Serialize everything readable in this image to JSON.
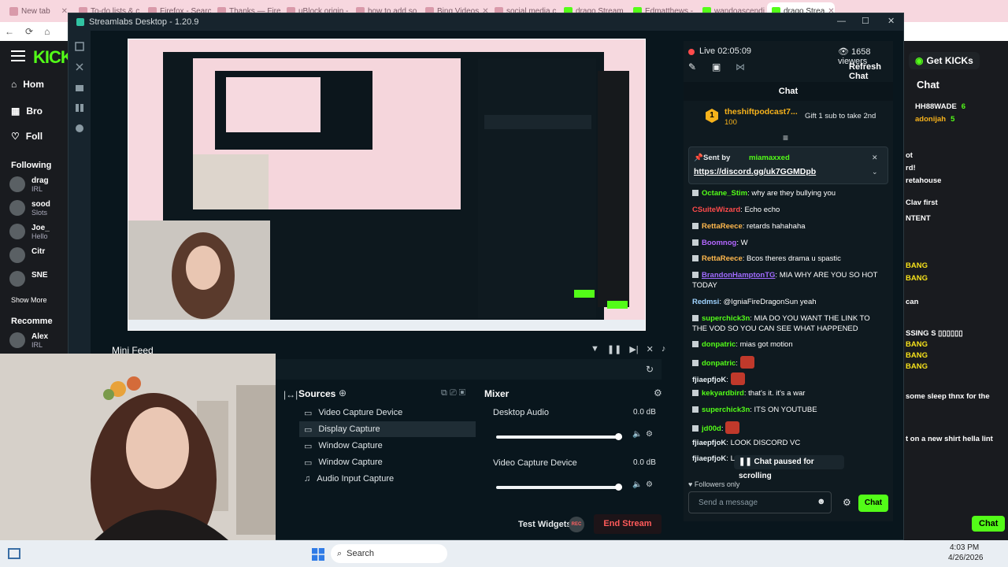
{
  "browser": {
    "tabs": [
      {
        "label": "New tab",
        "active": false,
        "kick": false
      },
      {
        "label": "To-do lists & c",
        "active": false,
        "kick": false
      },
      {
        "label": "Firefox - Search",
        "active": false,
        "kick": false
      },
      {
        "label": "Thanks — Firef",
        "active": false,
        "kick": false
      },
      {
        "label": "uBlock origin -",
        "active": false,
        "kick": false
      },
      {
        "label": "how to add so",
        "active": false,
        "kick": false
      },
      {
        "label": "Bing Videos",
        "active": false,
        "kick": false
      },
      {
        "label": "social media c",
        "active": false,
        "kick": false
      },
      {
        "label": "drago Stream",
        "active": false,
        "kick": true
      },
      {
        "label": "Edmatthews -",
        "active": false,
        "kick": true
      },
      {
        "label": "wandoascendi",
        "active": false,
        "kick": true
      },
      {
        "label": "drago Strea",
        "active": true,
        "kick": true
      }
    ]
  },
  "kick": {
    "logo": "KICK",
    "nav": [
      {
        "icon": "home-icon",
        "label": "Hom"
      },
      {
        "icon": "browse-icon",
        "label": "Bro"
      },
      {
        "icon": "heart-icon",
        "label": "Foll"
      }
    ],
    "following_label": "Following",
    "following": [
      {
        "name": "drag",
        "sub": "IRL"
      },
      {
        "name": "sood",
        "sub": "Slots"
      },
      {
        "name": "Joe_",
        "sub": "Hello"
      },
      {
        "name": "Citr",
        "sub": ""
      },
      {
        "name": "SNE",
        "sub": ""
      }
    ],
    "show_more": "Show More",
    "recommended_label": "Recomme",
    "recommended": [
      {
        "name": "Alex",
        "sub": "IRL"
      }
    ],
    "get_kicks": "Get KICKs",
    "right_chat_label": "Chat",
    "right_chat_lines": [
      {
        "user": "HH88WADE",
        "val": "6"
      },
      {
        "user": "adonijah",
        "val": "5"
      },
      {
        "text": "ot"
      },
      {
        "text": "rd!"
      },
      {
        "text": "retahouse"
      },
      {
        "text": "Clav first"
      },
      {
        "text": "NTENT"
      },
      {
        "text": "BANG"
      },
      {
        "text": "BANG"
      },
      {
        "text": "can"
      },
      {
        "text": "SSING S ▯▯▯▯▯▯"
      },
      {
        "text": "BANG"
      },
      {
        "text": "BANG"
      },
      {
        "text": "BANG"
      },
      {
        "text": "some sleep thnx for the"
      },
      {
        "text": "t on a new shirt hella lint"
      }
    ],
    "right_chat_button": "Chat"
  },
  "streamlabs": {
    "title": "Streamlabs Desktop - 1.20.9",
    "live_label": "Live 02:05:09",
    "viewers": "1658 viewers",
    "refresh_chat": "Refresh Chat",
    "chat_header": "Chat",
    "gift": {
      "user": "theshiftpodcast7...",
      "amount": "100",
      "text": "Gift 1 sub to take 2nd",
      "badge": "1"
    },
    "pinned": {
      "sent_by": "Sent by",
      "user": "miamaxxed",
      "link": "https://discord.gg/uk7GGMDpb"
    },
    "messages": [
      {
        "user": "Octane_Stim",
        "color": "#53fc18",
        "badge": true,
        "text": "why are they bullying you"
      },
      {
        "user": "CSuiteWizard",
        "color": "#ff4b4b",
        "badge": false,
        "text": "Echo echo"
      },
      {
        "user": "RettaReece",
        "color": "#ffb84d",
        "badge": true,
        "text": "retards hahahaha"
      },
      {
        "user": "Boomnog",
        "color": "#b366ff",
        "badge": true,
        "text": "W"
      },
      {
        "user": "RettaReece",
        "color": "#ffb84d",
        "badge": true,
        "text": "Bcos theres drama u spastic"
      },
      {
        "user": "BrandonHamptonTG",
        "color": "#a06bff",
        "badge": true,
        "text": "MIA WHY ARE YOU SO HOT TODAY"
      },
      {
        "user": "Redmsi",
        "color": "#9fd3ff",
        "badge": false,
        "text": "@IgniaFireDragonSun yeah"
      },
      {
        "user": "superchick3n",
        "color": "#53fc18",
        "badge": true,
        "text": "MIA DO YOU WANT THE LINK TO THE VOD SO YOU CAN SEE WHAT HAPPENED"
      },
      {
        "user": "donpatric",
        "color": "#53fc18",
        "badge": true,
        "text": "mias got motion"
      },
      {
        "user": "donpatric",
        "color": "#53fc18",
        "badge": true,
        "text": ""
      },
      {
        "user": "fjiaepfjoK",
        "color": "#e8f0f4",
        "badge": false,
        "text": ""
      },
      {
        "user": "kekyardbird",
        "color": "#53fc18",
        "badge": true,
        "text": "that's it. it's a war"
      },
      {
        "user": "superchick3n",
        "color": "#53fc18",
        "badge": true,
        "text": "ITS ON YOUTUBE"
      },
      {
        "user": "jd00d",
        "color": "#53fc18",
        "badge": true,
        "text": ""
      },
      {
        "user": "fjiaepfjoK",
        "color": "#e8f0f4",
        "badge": false,
        "text": "LOOK DISCORD VC"
      },
      {
        "user": "fjiaepfjoK",
        "color": "#e8f0f4",
        "badge": false,
        "text": "L"
      }
    ],
    "paused_text": "Chat paused for scrolling",
    "followers_only": "Followers only",
    "send_placeholder": "Send a message",
    "chat_button": "Chat",
    "mini_feed": "Mini Feed",
    "sources_label": "Sources",
    "sources": [
      {
        "label": "Video Capture Device",
        "icon": "camera-icon",
        "selected": false
      },
      {
        "label": "Display Capture",
        "icon": "monitor-icon",
        "selected": true
      },
      {
        "label": "Window Capture",
        "icon": "window-icon",
        "selected": false
      },
      {
        "label": "Window Capture",
        "icon": "window-icon",
        "selected": false
      },
      {
        "label": "Audio Input Capture",
        "icon": "mic-icon",
        "selected": false
      }
    ],
    "mixer_label": "Mixer",
    "mixer": [
      {
        "label": "Desktop Audio",
        "db": "0.0 dB",
        "level": 1.0
      },
      {
        "label": "Video Capture Device",
        "db": "0.0 dB",
        "level": 1.0
      }
    ],
    "test_widgets": "Test Widgets",
    "rec": "REC",
    "end_stream": "End Stream"
  },
  "taskbar": {
    "search": "Search",
    "time": "4:03 PM",
    "date": "4/26/2026"
  },
  "colors": {
    "kick_green": "#53fc18",
    "sl_bg": "#09161d",
    "end_stream": "#ff5a5a"
  }
}
